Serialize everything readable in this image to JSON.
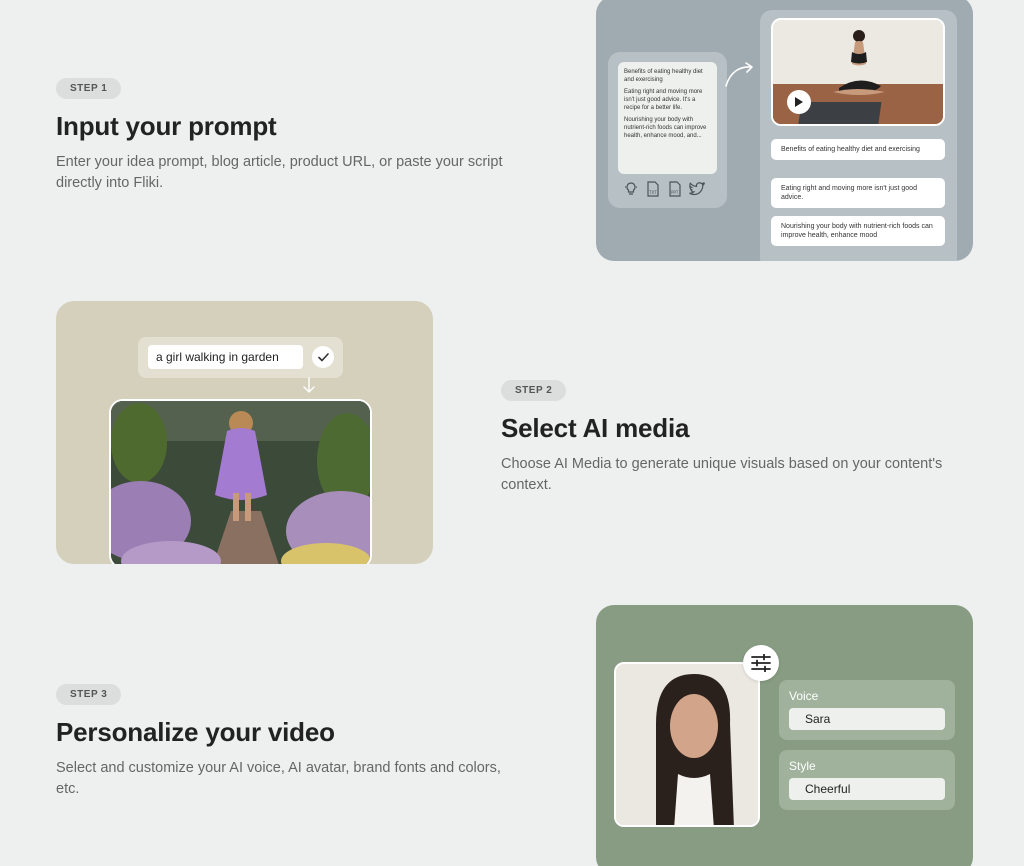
{
  "colors": {
    "page_bg": "#eef0ef",
    "card1_bg": "#9fabb0",
    "card2_bg": "#d4d0bc",
    "card3_bg": "#879c82",
    "pill_bg": "#dcdedd"
  },
  "steps": [
    {
      "pill": "STEP 1",
      "title": "Input your prompt",
      "description": "Enter your idea prompt, blog article, product URL, or paste your script directly into Fliki."
    },
    {
      "pill": "STEP 2",
      "title": "Select AI media",
      "description": "Choose AI Media to generate unique visuals based on your content's context."
    },
    {
      "pill": "STEP 3",
      "title": "Personalize your video",
      "description": "Select and customize your AI voice, AI avatar, brand fonts and colors, etc."
    }
  ],
  "card1": {
    "prompt_lines": [
      "Benefits of eating healthy diet and exercising",
      "Eating right and moving more isn't just good advice. It's a recipe for a better life.",
      "Nourishing your body with nutrient-rich foods can improve health, enhance mood, and..."
    ],
    "source_icons": [
      "lightbulb-icon",
      "txt-file-icon",
      "ppt-file-icon",
      "twitter-icon"
    ],
    "scenes": [
      "Benefits of eating healthy diet and exercising",
      "Eating right and moving more isn't just good advice.",
      "Nourishing your body with nutrient-rich foods can improve health, enhance mood"
    ]
  },
  "card2": {
    "prompt": "a girl walking in garden"
  },
  "card3": {
    "voice_label": "Voice",
    "voice_value": "Sara",
    "style_label": "Style",
    "style_value": "Cheerful"
  }
}
